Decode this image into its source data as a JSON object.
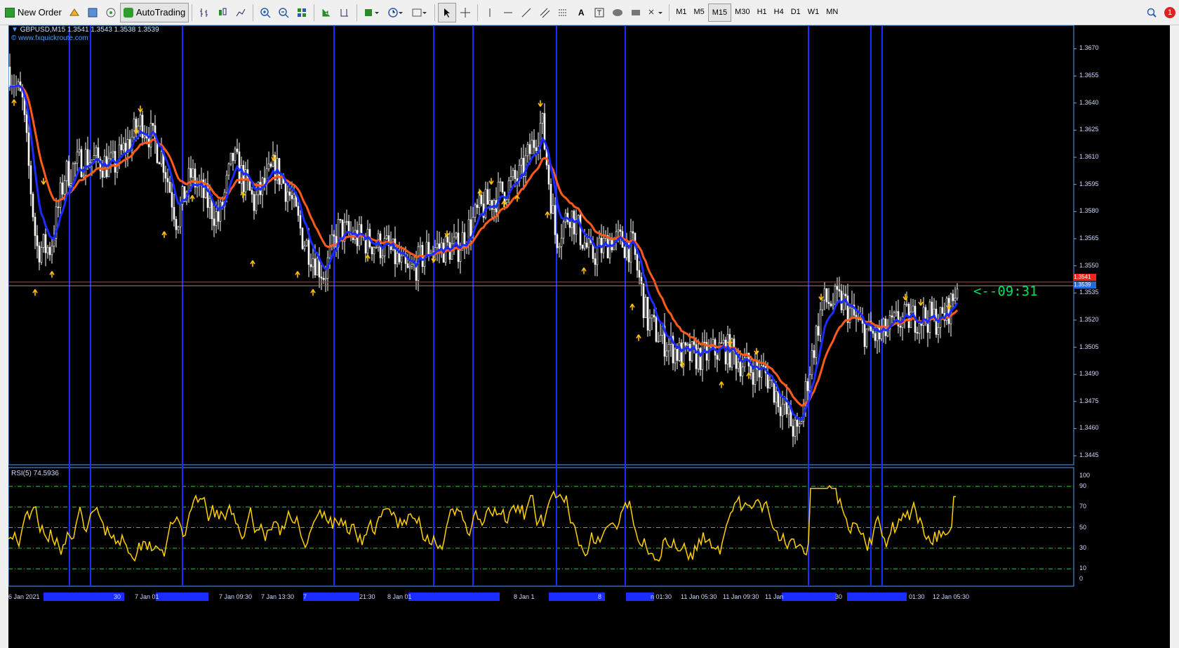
{
  "toolbar": {
    "new_order_label": "New Order",
    "autotrading_label": "AutoTrading",
    "timeframes": [
      "M1",
      "M5",
      "M15",
      "M30",
      "H1",
      "H4",
      "D1",
      "W1",
      "MN"
    ],
    "active_timeframe": "M15",
    "notification_count": "1"
  },
  "chart": {
    "header_symbol": "GBPUSD,M15  1.3541 1.3543 1.3538 1.3539",
    "header_copyright": "© www.fxquickroute.com",
    "countdown_label": "<--09:31",
    "bid_tag": "1.3541",
    "ask_tag": "1.3539",
    "price_axis": [
      "1.3670",
      "1.3655",
      "1.3640",
      "1.3625",
      "1.3610",
      "1.3595",
      "1.3580",
      "1.3565",
      "1.3550",
      "1.3535",
      "1.3520",
      "1.3505",
      "1.3490",
      "1.3475",
      "1.3460",
      "1.3445"
    ],
    "rsi_label": "RSI(5) 74.5936",
    "rsi_axis": [
      "100",
      "90",
      "70",
      "50",
      "30",
      "10",
      "0"
    ],
    "time_axis": [
      "6 Jan 2021",
      "30",
      "7 Jan 01",
      "7 Jan 09:30",
      "7 Jan 13:30",
      "7",
      "21:30",
      "8 Jan 01",
      "8 Jan 1",
      "8",
      "n 01:30",
      "11 Jan 05:30",
      "11 Jan 09:30",
      "11 Jan",
      "30",
      "01:30",
      "12 Jan 05:30"
    ],
    "colors": {
      "background": "#000000",
      "candles": "#ffffff",
      "fast_ma": "#1a2cff",
      "slow_ma": "#ff5a1a",
      "arrows": "#ffc000",
      "rsi_line": "#ffd000",
      "rsi_levels": "#3fbf3f",
      "vertical_lines": "#1a2cff",
      "bid_line": "#ff2020",
      "countdown": "#00e060",
      "axis_text": "#cfd8ff"
    }
  }
}
